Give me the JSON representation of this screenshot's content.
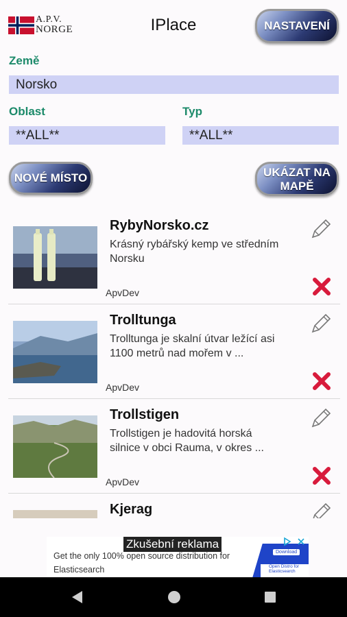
{
  "app": {
    "title": "IPlace",
    "logo_line1": "A.P.V.",
    "logo_line2": "NORGE",
    "settings_label": "NASTAVENÍ"
  },
  "filters": {
    "country_label": "Země",
    "country_value": "Norsko",
    "region_label": "Oblast",
    "region_value": "**ALL**",
    "type_label": "Typ",
    "type_value": "**ALL**"
  },
  "actions": {
    "new_place_label": "NOVÉ MÍSTO",
    "show_map_label": "UKÁZAT NA MAPĚ"
  },
  "places": [
    {
      "title": "RybyNorsko.cz",
      "description": "Krásný rybářský kemp ve středním Norsku",
      "author": "ApvDev"
    },
    {
      "title": "Trolltunga",
      "description": "Trolltunga je skalní útvar ležící asi 1100 metrů nad mořem v ...",
      "author": "ApvDev"
    },
    {
      "title": "Trollstigen",
      "description": "Trollstigen je hadovitá horská silnice v obci Rauma, v okres ...",
      "author": "ApvDev"
    },
    {
      "title": "Kjerag",
      "description": "",
      "author": ""
    }
  ],
  "ad": {
    "label": "Zkušební reklama",
    "text": "Get the only 100% open source distribution for Elasticsearch",
    "download": "Download",
    "brand": "Open Distro for Elasticsearch"
  },
  "colors": {
    "accent_label": "#1c8a6a",
    "field_bg": "#cfd2f5",
    "delete_red": "#d81b3c"
  }
}
